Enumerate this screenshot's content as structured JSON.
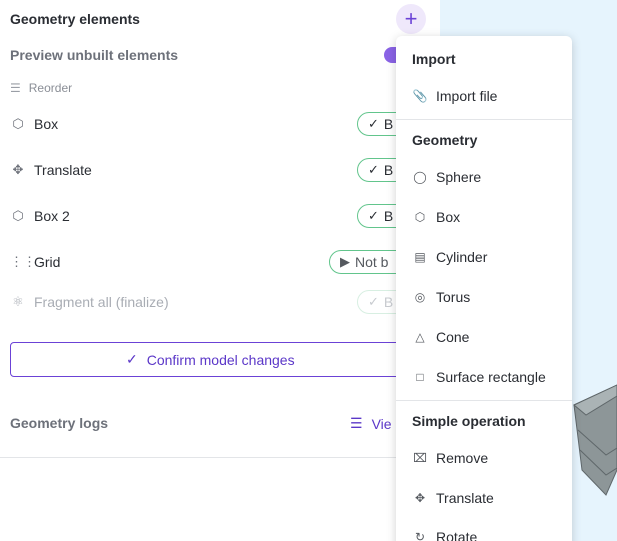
{
  "panel": {
    "title": "Geometry elements",
    "add_label": "+",
    "preview_label": "Preview unbuilt elements",
    "preview_enabled": true,
    "reorder_label": "Reorder",
    "elements": [
      {
        "icon": "cube-icon",
        "name": "Box",
        "status": "B",
        "state": "built"
      },
      {
        "icon": "move-icon",
        "name": "Translate",
        "status": "B",
        "state": "built"
      },
      {
        "icon": "cube-icon",
        "name": "Box 2",
        "status": "B",
        "state": "built"
      },
      {
        "icon": "grid-icon",
        "name": "Grid",
        "status": "Not b",
        "state": "not-built"
      },
      {
        "icon": "fragment-icon",
        "name": "Fragment all (finalize)",
        "status": "B",
        "state": "disabled"
      }
    ],
    "confirm_label": "Confirm model changes",
    "logs_label": "Geometry logs",
    "view_label": "Vie"
  },
  "menu": {
    "sections": [
      {
        "title": "Import",
        "items": [
          {
            "icon": "paperclip-icon",
            "label": "Import file"
          }
        ]
      },
      {
        "title": "Geometry",
        "items": [
          {
            "icon": "sphere-icon",
            "label": "Sphere"
          },
          {
            "icon": "cube-icon",
            "label": "Box"
          },
          {
            "icon": "cylinder-icon",
            "label": "Cylinder"
          },
          {
            "icon": "torus-icon",
            "label": "Torus"
          },
          {
            "icon": "cone-icon",
            "label": "Cone"
          },
          {
            "icon": "square-icon",
            "label": "Surface rectangle"
          }
        ]
      },
      {
        "title": "Simple operation",
        "items": [
          {
            "icon": "remove-icon",
            "label": "Remove"
          },
          {
            "icon": "move-icon",
            "label": "Translate"
          },
          {
            "icon": "rotate-icon",
            "label": "Rotate"
          }
        ]
      }
    ]
  },
  "colors": {
    "accent": "#6b42d6",
    "built": "#62c58c",
    "viewport": "#e6f4fd"
  }
}
